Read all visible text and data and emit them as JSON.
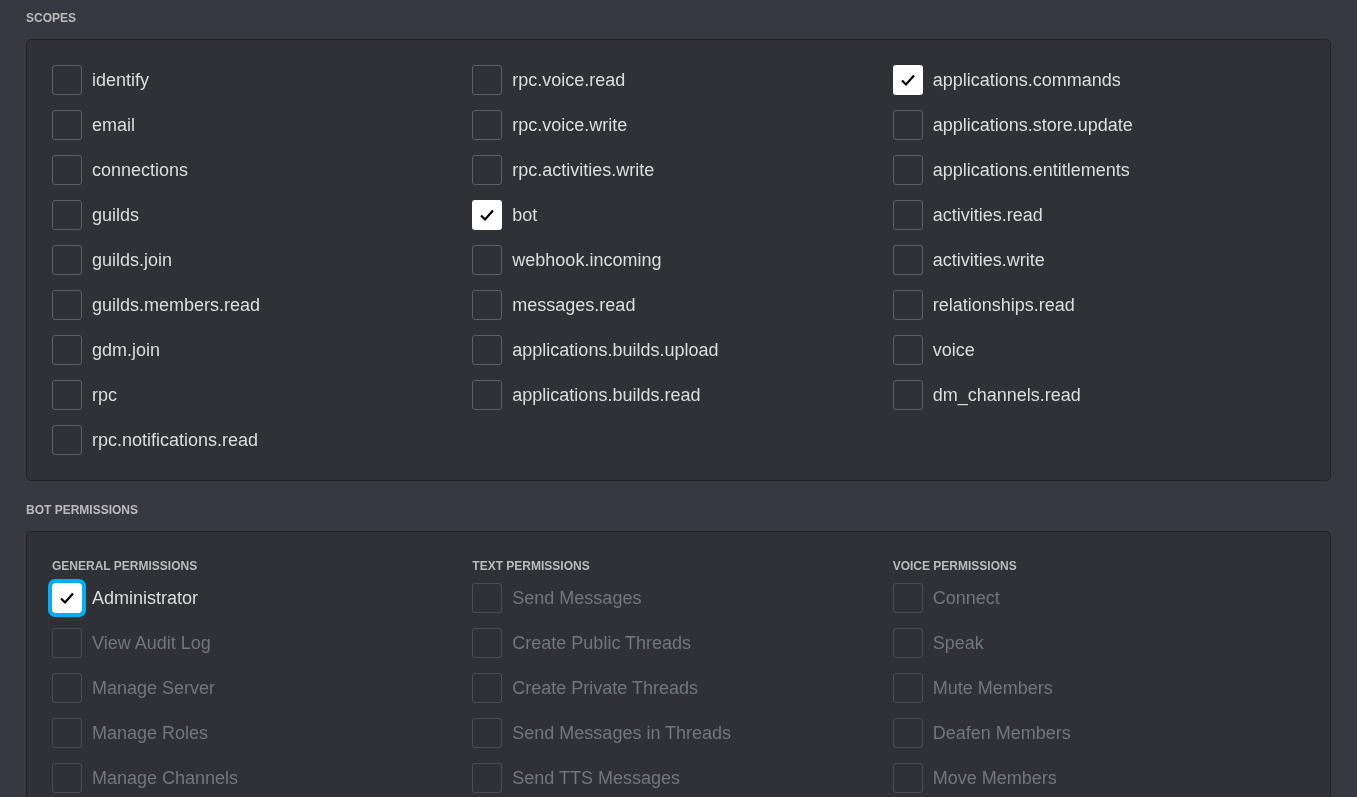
{
  "scopes": {
    "heading": "SCOPES",
    "columns": [
      [
        {
          "label": "identify",
          "checked": false
        },
        {
          "label": "email",
          "checked": false
        },
        {
          "label": "connections",
          "checked": false
        },
        {
          "label": "guilds",
          "checked": false
        },
        {
          "label": "guilds.join",
          "checked": false
        },
        {
          "label": "guilds.members.read",
          "checked": false
        },
        {
          "label": "gdm.join",
          "checked": false
        },
        {
          "label": "rpc",
          "checked": false
        },
        {
          "label": "rpc.notifications.read",
          "checked": false
        }
      ],
      [
        {
          "label": "rpc.voice.read",
          "checked": false
        },
        {
          "label": "rpc.voice.write",
          "checked": false
        },
        {
          "label": "rpc.activities.write",
          "checked": false
        },
        {
          "label": "bot",
          "checked": true
        },
        {
          "label": "webhook.incoming",
          "checked": false
        },
        {
          "label": "messages.read",
          "checked": false
        },
        {
          "label": "applications.builds.upload",
          "checked": false
        },
        {
          "label": "applications.builds.read",
          "checked": false
        }
      ],
      [
        {
          "label": "applications.commands",
          "checked": true
        },
        {
          "label": "applications.store.update",
          "checked": false
        },
        {
          "label": "applications.entitlements",
          "checked": false
        },
        {
          "label": "activities.read",
          "checked": false
        },
        {
          "label": "activities.write",
          "checked": false
        },
        {
          "label": "relationships.read",
          "checked": false
        },
        {
          "label": "voice",
          "checked": false
        },
        {
          "label": "dm_channels.read",
          "checked": false
        }
      ]
    ]
  },
  "bot_permissions": {
    "heading": "BOT PERMISSIONS",
    "groups": [
      {
        "heading": "GENERAL PERMISSIONS",
        "items": [
          {
            "label": "Administrator",
            "checked": true,
            "disabled": false,
            "focused": true
          },
          {
            "label": "View Audit Log",
            "checked": false,
            "disabled": true,
            "focused": false
          },
          {
            "label": "Manage Server",
            "checked": false,
            "disabled": true,
            "focused": false
          },
          {
            "label": "Manage Roles",
            "checked": false,
            "disabled": true,
            "focused": false
          },
          {
            "label": "Manage Channels",
            "checked": false,
            "disabled": true,
            "focused": false
          }
        ]
      },
      {
        "heading": "TEXT PERMISSIONS",
        "items": [
          {
            "label": "Send Messages",
            "checked": false,
            "disabled": true,
            "focused": false
          },
          {
            "label": "Create Public Threads",
            "checked": false,
            "disabled": true,
            "focused": false
          },
          {
            "label": "Create Private Threads",
            "checked": false,
            "disabled": true,
            "focused": false
          },
          {
            "label": "Send Messages in Threads",
            "checked": false,
            "disabled": true,
            "focused": false
          },
          {
            "label": "Send TTS Messages",
            "checked": false,
            "disabled": true,
            "focused": false
          }
        ]
      },
      {
        "heading": "VOICE PERMISSIONS",
        "items": [
          {
            "label": "Connect",
            "checked": false,
            "disabled": true,
            "focused": false
          },
          {
            "label": "Speak",
            "checked": false,
            "disabled": true,
            "focused": false
          },
          {
            "label": "Mute Members",
            "checked": false,
            "disabled": true,
            "focused": false
          },
          {
            "label": "Deafen Members",
            "checked": false,
            "disabled": true,
            "focused": false
          },
          {
            "label": "Move Members",
            "checked": false,
            "disabled": true,
            "focused": false
          }
        ]
      }
    ]
  }
}
